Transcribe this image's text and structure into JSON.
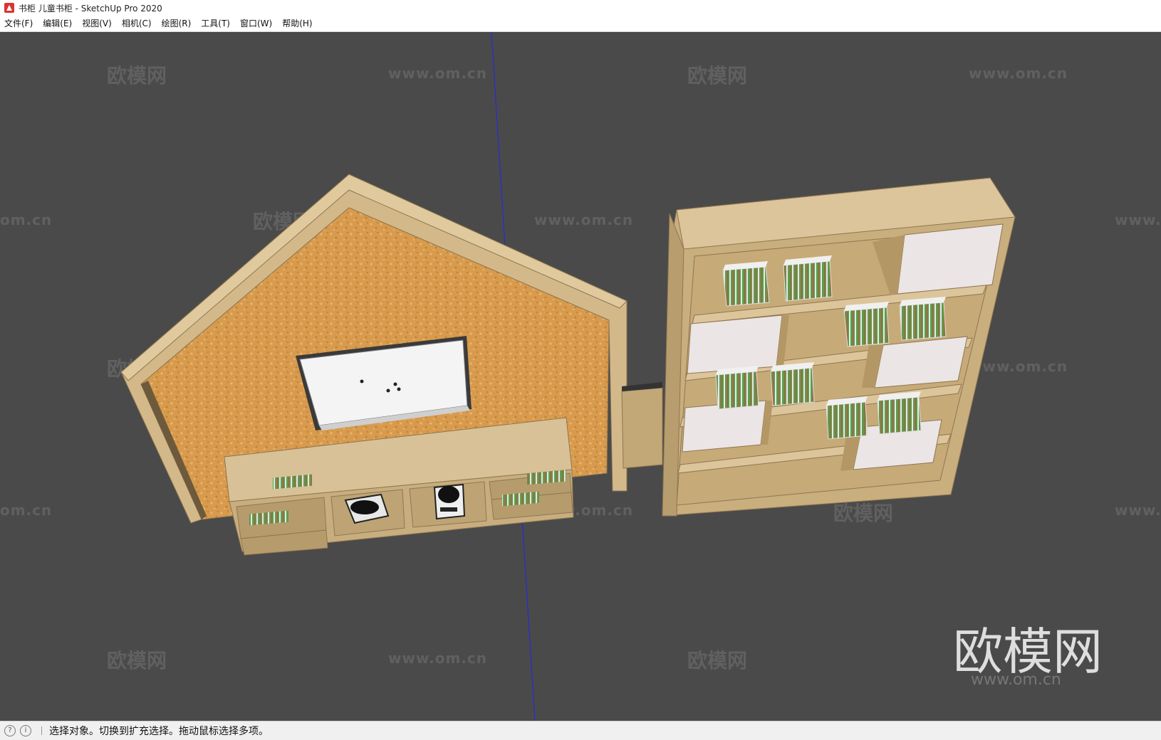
{
  "window": {
    "title": "书柜 儿童书柜 - SketchUp Pro 2020",
    "icon": "sketchup-logo-icon"
  },
  "menu": {
    "items": [
      {
        "label": "文件(F)"
      },
      {
        "label": "编辑(E)"
      },
      {
        "label": "视图(V)"
      },
      {
        "label": "相机(C)"
      },
      {
        "label": "绘图(R)"
      },
      {
        "label": "工具(T)"
      },
      {
        "label": "窗口(W)"
      },
      {
        "label": "帮助(H)"
      }
    ]
  },
  "watermarks": {
    "cn": "欧模网",
    "url": "www.om.cn",
    "url_partial_left": "om.cn",
    "url_partial_right": "www."
  },
  "logo": {
    "text": "欧模网",
    "url": "www.om.cn"
  },
  "status": {
    "icon1": "geo-location-icon",
    "icon2": "info-icon",
    "text": "选择对象。切换到扩充选择。拖动鼠标选择多项。"
  },
  "colors": {
    "viewport_bg": "#4a4a4a",
    "wood": "#d3b98a",
    "wood_dark": "#a88e62",
    "cork": "#d79a4c",
    "axis_blue": "#2a2ad8"
  }
}
